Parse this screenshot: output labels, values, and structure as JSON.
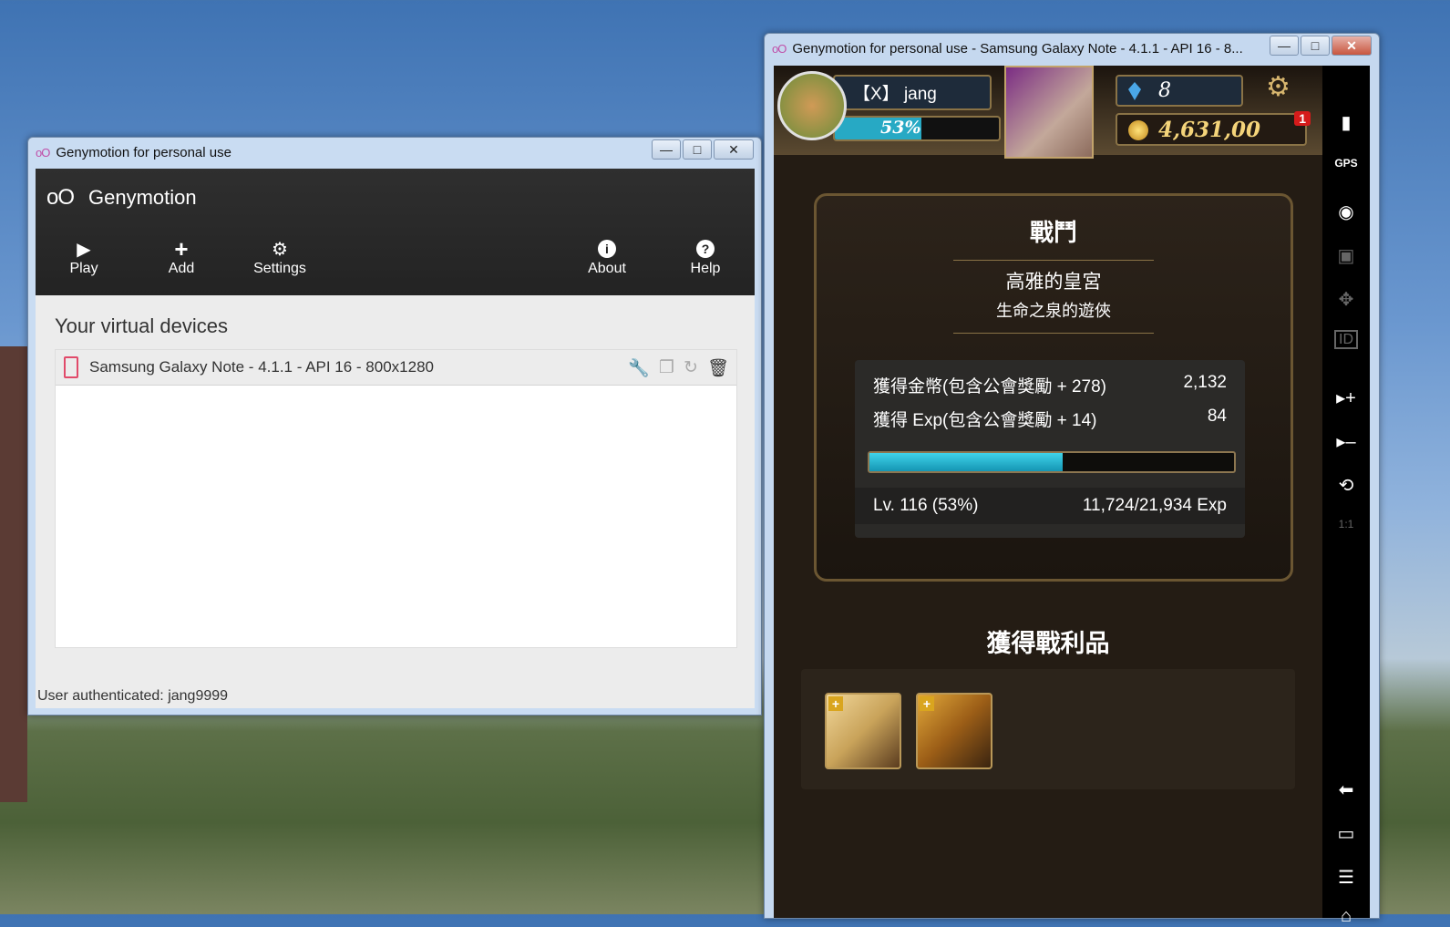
{
  "launcher": {
    "window_title": "Genymotion for personal use",
    "app_name": "Genymotion",
    "toolbar": {
      "play": "Play",
      "add": "Add",
      "settings": "Settings",
      "about": "About",
      "help": "Help"
    },
    "section_title": "Your virtual devices",
    "devices": [
      {
        "name": "Samsung Galaxy Note - 4.1.1 - API 16 - 800x1280"
      }
    ],
    "status": "User authenticated: jang9999"
  },
  "emulator": {
    "window_title": "Genymotion for personal use - Samsung Galaxy Note - 4.1.1 - API 16 - 8...",
    "sidebar_icons": [
      "battery-icon",
      "gps-icon",
      "webcam-icon",
      "capture-icon",
      "dpad-icon",
      "device-id-icon",
      "volume-up-icon",
      "volume-down-icon",
      "rotate-icon",
      "scale-icon",
      "back-icon",
      "recent-apps-icon",
      "menu-icon",
      "home-icon"
    ],
    "sidebar_gps_label": "GPS",
    "sidebar_id_label": "ID",
    "sidebar_scale_label": "1:1"
  },
  "game": {
    "player_name": "【X】 jang",
    "xp_percent_text": "53%",
    "xp_fraction": 0.53,
    "gems": "8",
    "coins": "4,631,00",
    "coin_badge": "1",
    "battle_title": "戰鬥",
    "stage_name": "高雅的皇宮",
    "stage_sub": "生命之泉的遊俠",
    "gold_label": "獲得金幣(包含公會獎勵 + 278)",
    "gold_value": "2,132",
    "exp_label": "獲得 Exp(包含公會獎勵 + 14)",
    "exp_value": "84",
    "exp_bar_fraction": 0.53,
    "level_text": "Lv. 116 (53%)",
    "exp_progress_text": "11,724/21,934 Exp",
    "loot_title": "獲得戰利品"
  },
  "colors": {
    "accent_cyan": "#27a9c4",
    "genymotion_pink": "#e14a6a",
    "badge_red": "#d51b1b"
  }
}
